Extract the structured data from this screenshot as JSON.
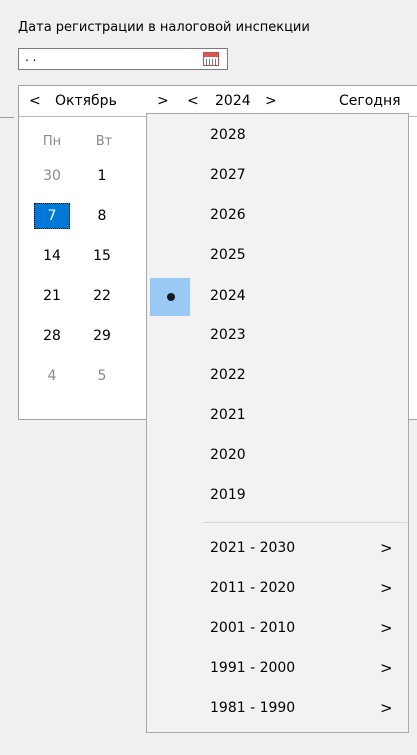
{
  "field": {
    "label": "Дата регистрации в налоговой инспекции",
    "value": " .  ."
  },
  "calendar": {
    "prev_month": "<",
    "month": "Октябрь",
    "next_month": ">",
    "prev_year": "<",
    "year": "2024",
    "next_year": ">",
    "today": "Сегодня",
    "weekdays": [
      "Пн",
      "Вт"
    ],
    "weeks": [
      [
        "30",
        "1"
      ],
      [
        "7",
        "8"
      ],
      [
        "14",
        "15"
      ],
      [
        "21",
        "22"
      ],
      [
        "28",
        "29"
      ],
      [
        "4",
        "5"
      ]
    ],
    "selected_day": "7"
  },
  "year_menu": {
    "years": [
      "2028",
      "2027",
      "2026",
      "2025",
      "2024",
      "2023",
      "2022",
      "2021",
      "2020",
      "2019"
    ],
    "checked_year": "2024",
    "ranges": [
      "2021 - 2030",
      "2011 - 2020",
      "2001 - 2010",
      "1991 - 2000",
      "1981 - 1990"
    ],
    "submenu_arrow": ">"
  },
  "colors": {
    "selection": "#0078d7",
    "checked_highlight": "#99c9f5"
  },
  "icons": {
    "calendar_button": "calendar-icon",
    "check_mark": "bullet-dot-icon"
  }
}
